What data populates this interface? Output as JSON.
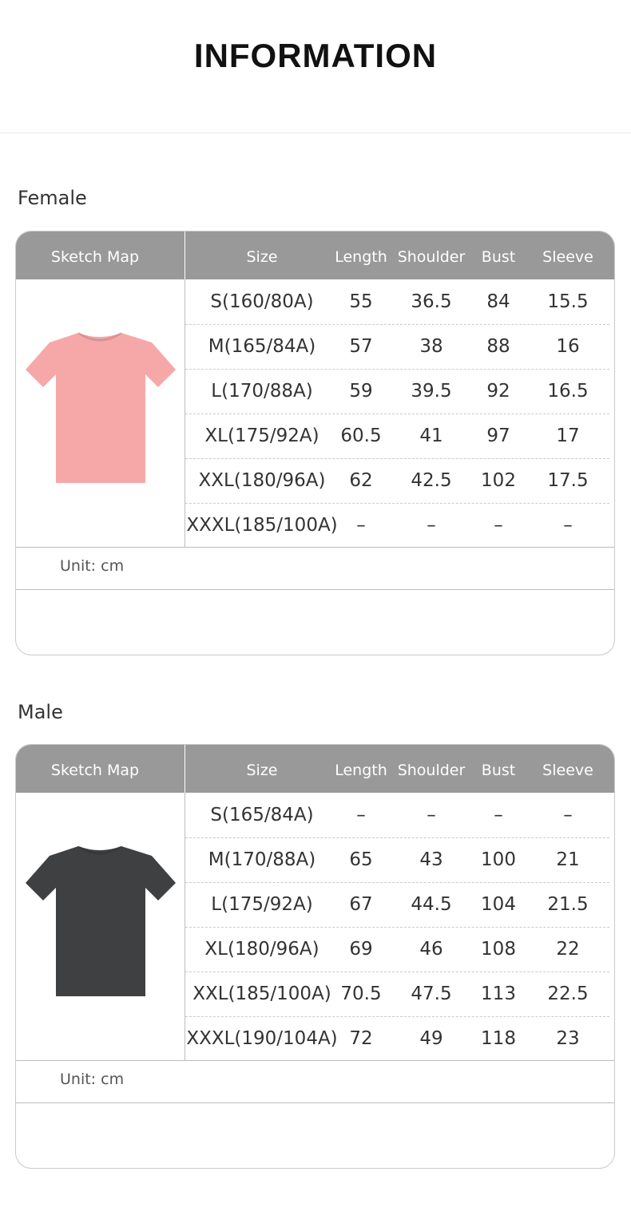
{
  "page": {
    "title": "INFORMATION"
  },
  "headers": [
    "Sketch Map",
    "Size",
    "Length",
    "Shoulder",
    "Bust",
    "Sleeve"
  ],
  "female": {
    "label": "Female",
    "shirt_color": "#f6a8a8",
    "shirt_icon": "pink-tshirt-icon",
    "rows": [
      {
        "size": "S(160/80A)",
        "length": "55",
        "shoulder": "36.5",
        "bust": "84",
        "sleeve": "15.5"
      },
      {
        "size": "M(165/84A)",
        "length": "57",
        "shoulder": "38",
        "bust": "88",
        "sleeve": "16"
      },
      {
        "size": "L(170/88A)",
        "length": "59",
        "shoulder": "39.5",
        "bust": "92",
        "sleeve": "16.5"
      },
      {
        "size": "XL(175/92A)",
        "length": "60.5",
        "shoulder": "41",
        "bust": "97",
        "sleeve": "17"
      },
      {
        "size": "XXL(180/96A)",
        "length": "62",
        "shoulder": "42.5",
        "bust": "102",
        "sleeve": "17.5"
      },
      {
        "size": "XXXL(185/100A)",
        "length": "–",
        "shoulder": "–",
        "bust": "–",
        "sleeve": "–"
      }
    ],
    "unit": "Unit: cm"
  },
  "male": {
    "label": "Male",
    "shirt_color": "#3f4042",
    "shirt_icon": "dark-gray-tshirt-icon",
    "rows": [
      {
        "size": "S(165/84A)",
        "length": "–",
        "shoulder": "–",
        "bust": "–",
        "sleeve": "–"
      },
      {
        "size": "M(170/88A)",
        "length": "65",
        "shoulder": "43",
        "bust": "100",
        "sleeve": "21"
      },
      {
        "size": "L(175/92A)",
        "length": "67",
        "shoulder": "44.5",
        "bust": "104",
        "sleeve": "21.5"
      },
      {
        "size": "XL(180/96A)",
        "length": "69",
        "shoulder": "46",
        "bust": "108",
        "sleeve": "22"
      },
      {
        "size": "XXL(185/100A)",
        "length": "70.5",
        "shoulder": "47.5",
        "bust": "113",
        "sleeve": "22.5"
      },
      {
        "size": "XXXL(190/104A)",
        "length": "72",
        "shoulder": "49",
        "bust": "118",
        "sleeve": "23"
      }
    ],
    "unit": "Unit: cm"
  }
}
